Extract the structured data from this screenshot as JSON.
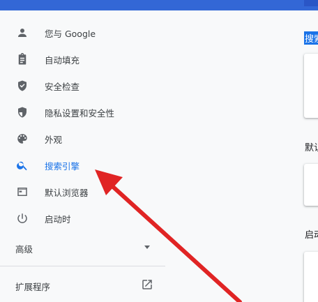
{
  "sidebar": {
    "items": [
      {
        "label": "您与 Google",
        "icon": "person-icon"
      },
      {
        "label": "自动填充",
        "icon": "clipboard-icon"
      },
      {
        "label": "安全检查",
        "icon": "shield-check-icon"
      },
      {
        "label": "隐私设置和安全性",
        "icon": "shield-half-icon"
      },
      {
        "label": "外观",
        "icon": "palette-icon"
      },
      {
        "label": "搜索引擎",
        "icon": "search-icon"
      },
      {
        "label": "默认浏览器",
        "icon": "browser-window-icon"
      },
      {
        "label": "启动时",
        "icon": "power-icon"
      }
    ],
    "active_index": 5,
    "advanced_label": "高级",
    "extensions_label": "扩展程序"
  },
  "main": {
    "section_search": "搜索",
    "section_default": "默认",
    "section_startup": "启动"
  },
  "colors": {
    "accent": "#1a73e8",
    "topbar": "#3367d6",
    "annotation_arrow": "#e02424"
  }
}
